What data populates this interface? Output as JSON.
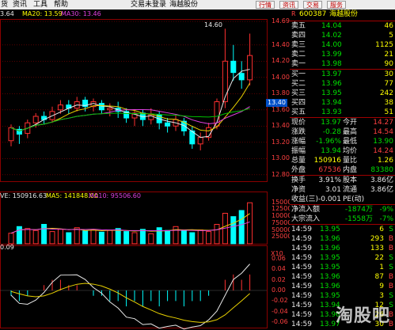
{
  "menubar": {
    "items": [
      "货",
      "资讯",
      "工具",
      "帮助"
    ],
    "center": [
      "交易未登录",
      "海越股份"
    ],
    "right_buttons": [
      "行情",
      "资讯",
      "交易",
      "服务"
    ]
  },
  "chart": {
    "top_ma": {
      "price": "3.64",
      "ma20": "MA20: 13.59",
      "ma30": "MA30: 13.46"
    },
    "high_annotation": "14.60",
    "price_axis": [
      "14.69",
      "14.40",
      "14.20",
      "14.00",
      "13.80",
      "13.60",
      "13.40",
      "13.20",
      "13.00",
      "12.80"
    ],
    "price_tag": "13.40",
    "vol_header": {
      "vol": "VE: 150916.63",
      "ma5": "MA5: 141848.00",
      "ma10": "MA10: 95506.60"
    },
    "vol_axis": [
      "150000",
      "125000",
      "100000",
      "75000",
      "50000",
      "25000"
    ],
    "vol_unit": "X10",
    "macd_header": "0.09",
    "macd_axis": [
      "0.06",
      "0.04",
      "0.02",
      "0.00",
      "-0.02",
      "-0.04",
      "-0.06"
    ],
    "colors": {
      "up": "#00ffff",
      "down": "#ff3030",
      "grid": "#8b0000",
      "ma_white": "#e8e8e8",
      "ma_yellow": "#e8d000",
      "ma_magenta": "#e040e0",
      "ma_green": "#00c000"
    },
    "candles": [
      {
        "o": 13.22,
        "c": 13.38,
        "h": 13.42,
        "l": 13.15
      },
      {
        "o": 13.36,
        "c": 13.3,
        "h": 13.4,
        "l": 13.18
      },
      {
        "o": 13.31,
        "c": 13.44,
        "h": 13.48,
        "l": 13.25
      },
      {
        "o": 13.44,
        "c": 13.52,
        "h": 13.56,
        "l": 13.38
      },
      {
        "o": 13.52,
        "c": 13.48,
        "h": 13.58,
        "l": 13.42
      },
      {
        "o": 13.48,
        "c": 13.58,
        "h": 13.64,
        "l": 13.44
      },
      {
        "o": 13.6,
        "c": 13.66,
        "h": 13.72,
        "l": 13.55
      },
      {
        "o": 13.66,
        "c": 13.62,
        "h": 13.72,
        "l": 13.55
      },
      {
        "o": 13.62,
        "c": 13.7,
        "h": 13.76,
        "l": 13.58
      },
      {
        "o": 13.72,
        "c": 13.64,
        "h": 13.76,
        "l": 13.58
      },
      {
        "o": 13.64,
        "c": 13.7,
        "h": 13.74,
        "l": 13.58
      },
      {
        "o": 13.68,
        "c": 13.6,
        "h": 13.72,
        "l": 13.55
      },
      {
        "o": 13.6,
        "c": 13.62,
        "h": 13.68,
        "l": 13.52
      },
      {
        "o": 13.62,
        "c": 13.58,
        "h": 13.7,
        "l": 13.5
      },
      {
        "o": 13.58,
        "c": 13.5,
        "h": 13.62,
        "l": 13.44
      },
      {
        "o": 13.5,
        "c": 13.56,
        "h": 13.6,
        "l": 13.4
      },
      {
        "o": 13.56,
        "c": 13.48,
        "h": 13.6,
        "l": 13.4
      },
      {
        "o": 13.48,
        "c": 13.54,
        "h": 13.62,
        "l": 13.42
      },
      {
        "o": 13.54,
        "c": 13.44,
        "h": 13.58,
        "l": 13.36
      },
      {
        "o": 13.44,
        "c": 13.4,
        "h": 13.5,
        "l": 13.32
      },
      {
        "o": 13.4,
        "c": 13.48,
        "h": 13.54,
        "l": 13.34
      },
      {
        "o": 13.46,
        "c": 13.34,
        "h": 13.5,
        "l": 13.28
      },
      {
        "o": 13.34,
        "c": 13.18,
        "h": 13.4,
        "l": 13.12
      },
      {
        "o": 13.18,
        "c": 13.26,
        "h": 13.32,
        "l": 13.1
      },
      {
        "o": 13.26,
        "c": 13.38,
        "h": 13.44,
        "l": 13.22
      },
      {
        "o": 13.4,
        "c": 13.7,
        "h": 13.74,
        "l": 13.36
      },
      {
        "o": 13.7,
        "c": 14.2,
        "h": 14.6,
        "l": 13.62
      },
      {
        "o": 14.2,
        "c": 14.06,
        "h": 14.4,
        "l": 13.96
      },
      {
        "o": 14.05,
        "c": 13.97,
        "h": 14.2,
        "l": 13.86
      },
      {
        "o": 13.97,
        "c": 14.27,
        "h": 14.54,
        "l": 13.9
      }
    ],
    "volumes": [
      38,
      62,
      55,
      48,
      70,
      44,
      52,
      40,
      58,
      46,
      50,
      42,
      48,
      55,
      44,
      40,
      52,
      36,
      58,
      48,
      62,
      46,
      40,
      50,
      44,
      70,
      110,
      98,
      120,
      148
    ],
    "macd_bars": [
      -0.01,
      -0.02,
      -0.01,
      0.0,
      0.01,
      0.02,
      0.02,
      0.01,
      0.01,
      0.0,
      -0.01,
      -0.01,
      -0.02,
      -0.02,
      -0.03,
      -0.02,
      -0.03,
      -0.02,
      -0.03,
      -0.02,
      -0.02,
      -0.03,
      -0.02,
      -0.02,
      -0.01,
      0.0,
      0.02,
      0.03,
      0.02,
      0.03
    ]
  },
  "quote": {
    "code": "600387",
    "name": "海越股份",
    "asks": [
      {
        "label": "卖五",
        "price": "14.04",
        "vol": "46"
      },
      {
        "label": "卖四",
        "price": "14.02",
        "vol": "5"
      },
      {
        "label": "卖三",
        "price": "14.00",
        "vol": "1125"
      },
      {
        "label": "卖二",
        "price": "13.99",
        "vol": "21"
      },
      {
        "label": "卖一",
        "price": "13.98",
        "vol": "90"
      }
    ],
    "bids": [
      {
        "label": "买一",
        "price": "13.97",
        "vol": "30"
      },
      {
        "label": "买二",
        "price": "13.96",
        "vol": "77"
      },
      {
        "label": "买三",
        "price": "13.95",
        "vol": "242"
      },
      {
        "label": "买四",
        "price": "13.94",
        "vol": "38"
      },
      {
        "label": "买五",
        "price": "13.93",
        "vol": "51"
      }
    ],
    "stats": [
      {
        "l1": "现价",
        "v1": "13.97",
        "l2": "今开",
        "v2": "14.27"
      },
      {
        "l1": "涨跌",
        "v1": "-0.28",
        "l2": "最高",
        "v2": "14.54"
      },
      {
        "l1": "涨幅",
        "v1": "-1.96%",
        "l2": "最低",
        "v2": "13.90"
      },
      {
        "l1": "振幅",
        "v1": "13.94",
        "l2": "均价",
        "v2": "14.24"
      },
      {
        "l1": "总量",
        "v1": "150916",
        "l2": "量比",
        "v2": "1.26"
      },
      {
        "l1": "外盘",
        "v1": "67536",
        "l2": "内盘",
        "v2": "83380"
      }
    ],
    "extra": [
      {
        "l1": "换手",
        "v1": "3.91%",
        "l2": "股本",
        "v2": "3.86亿"
      },
      {
        "l1": "净资",
        "v1": "3.01",
        "l2": "流通",
        "v2": "3.86亿"
      },
      {
        "l1": "收益(三)",
        "v1": "-0.001",
        "l2": "PE(动)",
        "v2": ""
      }
    ],
    "flows": [
      {
        "label": "净流入额",
        "v1": "-1874万",
        "v2": "-9%"
      },
      {
        "label": "大宗流入",
        "v1": "-1558万",
        "v2": "-7%"
      }
    ],
    "ticks": [
      {
        "t": "14:59",
        "p": "13.95",
        "v": "6",
        "s": "S"
      },
      {
        "t": "14:59",
        "p": "13.96",
        "v": "293",
        "s": "B"
      },
      {
        "t": "14:59",
        "p": "13.96",
        "v": "133",
        "s": "B"
      },
      {
        "t": "14:59",
        "p": "13.95",
        "v": "22",
        "s": "S"
      },
      {
        "t": "14:59",
        "p": "13.95",
        "v": "1",
        "s": "S"
      },
      {
        "t": "14:59",
        "p": "13.96",
        "v": "87",
        "s": "B"
      },
      {
        "t": "14:59",
        "p": "13.96",
        "v": "9",
        "s": "B"
      },
      {
        "t": "14:59",
        "p": "13.95",
        "v": "3",
        "s": "S"
      },
      {
        "t": "14:59",
        "p": "13.94",
        "v": "12",
        "s": "S"
      },
      {
        "t": "14:59",
        "p": "13.96",
        "v": "26",
        "s": "B"
      },
      {
        "t": "14:59",
        "p": "13.97",
        "v": "30",
        "s": "B"
      }
    ],
    "watermark": "淘股吧"
  }
}
